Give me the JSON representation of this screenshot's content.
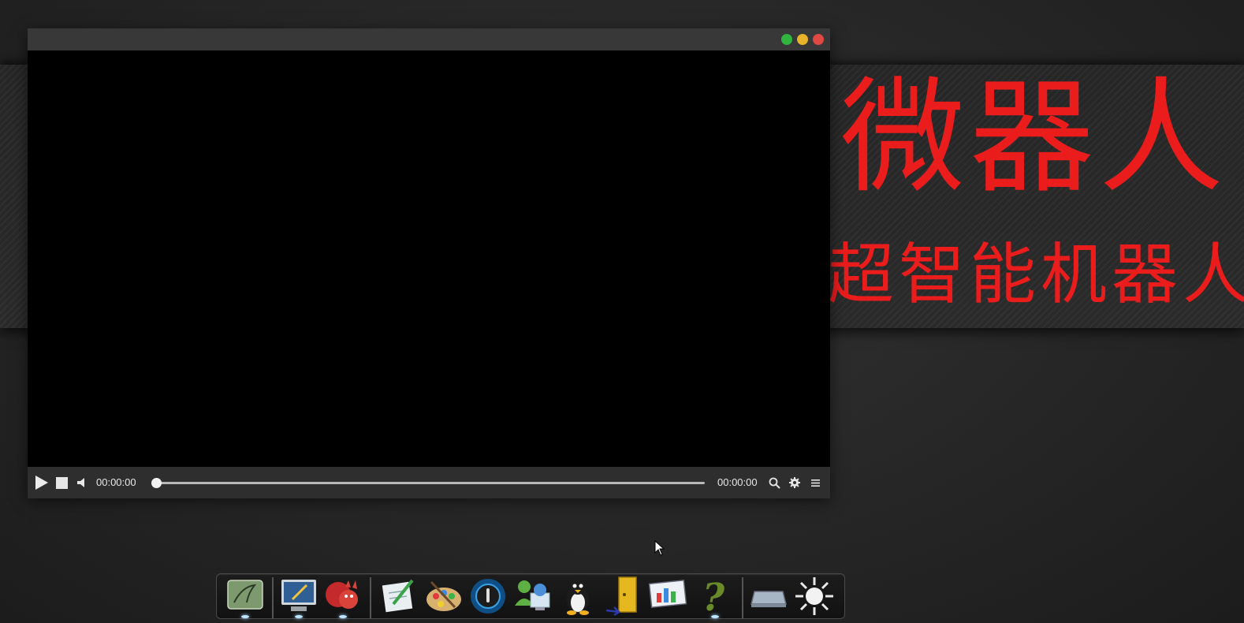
{
  "banner": {
    "title": "微器人",
    "subtitle": "型超智能机器人",
    "text_color": "#ea1c1c"
  },
  "player": {
    "window_controls": [
      {
        "name": "maximize",
        "color": "#2fb43e"
      },
      {
        "name": "minimize",
        "color": "#e8b22a"
      },
      {
        "name": "close",
        "color": "#e04842"
      }
    ],
    "current_time": "00:00:00",
    "total_time": "00:00:00",
    "progress": 0,
    "icons": [
      "play-icon",
      "stop-icon",
      "volume-icon",
      "search-icon",
      "gear-icon",
      "menu-icon"
    ]
  },
  "dock": {
    "items": [
      {
        "name": "finder-icon",
        "running": true
      },
      {
        "name": "monitor-icon",
        "running": true
      },
      {
        "name": "squirrel-icon",
        "running": true
      },
      {
        "name": "notepad-icon",
        "running": false
      },
      {
        "name": "paint-palette-icon",
        "running": false
      },
      {
        "name": "music-player-icon",
        "running": false
      },
      {
        "name": "user-network-icon",
        "running": false
      },
      {
        "name": "penguin-icon",
        "running": false
      },
      {
        "name": "exit-door-icon",
        "running": false
      },
      {
        "name": "chart-presentation-icon",
        "running": false
      },
      {
        "name": "help-icon",
        "running": true
      },
      {
        "name": "drive-icon",
        "running": false
      },
      {
        "name": "brightness-icon",
        "running": false
      }
    ]
  }
}
